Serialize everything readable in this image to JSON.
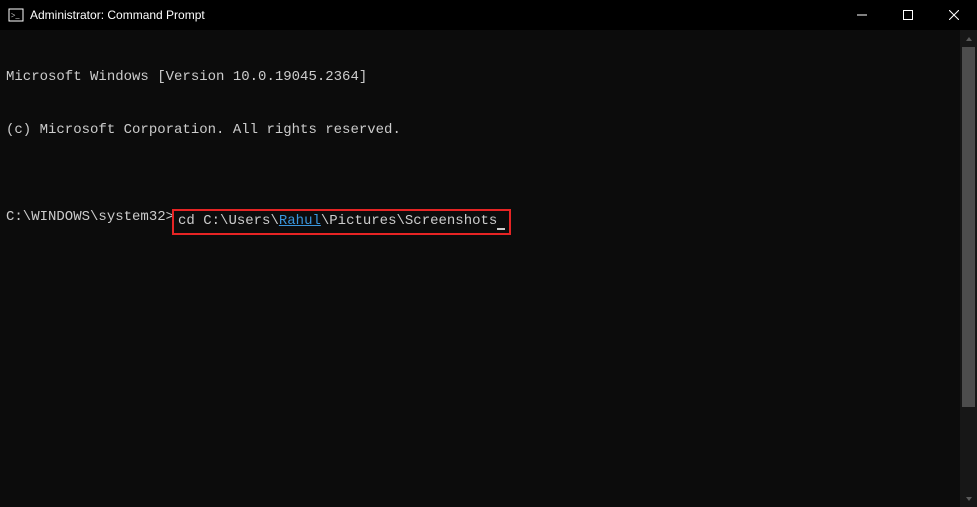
{
  "titlebar": {
    "title": "Administrator: Command Prompt"
  },
  "terminal": {
    "line1": "Microsoft Windows [Version 10.0.19045.2364]",
    "line2": "(c) Microsoft Corporation. All rights reserved.",
    "blank": "",
    "prompt": "C:\\WINDOWS\\system32>",
    "command_pre": "cd C:\\Users\\",
    "command_user": "Rahul",
    "command_post": "\\Pictures\\Screenshots"
  }
}
